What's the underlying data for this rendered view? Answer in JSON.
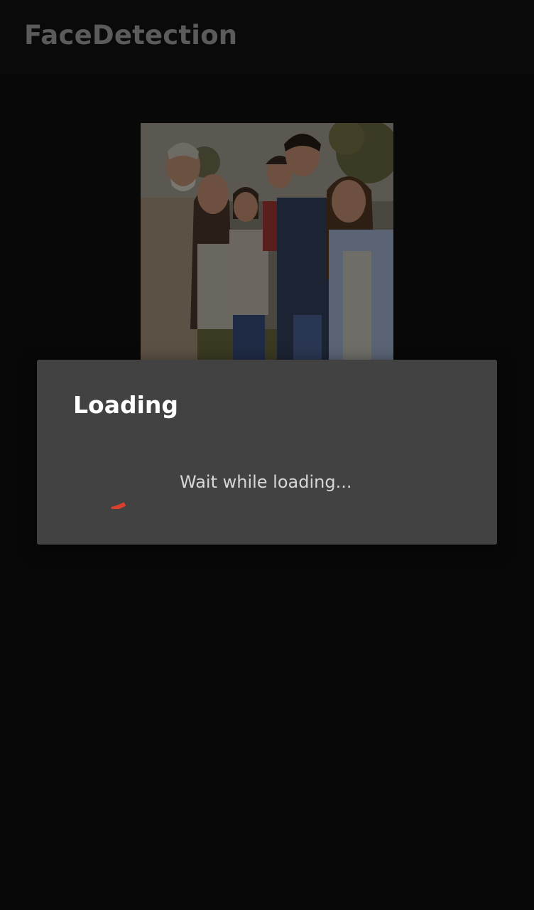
{
  "app_bar": {
    "title": "FaceDetection"
  },
  "content": {
    "photo_icon": "group-photo-image"
  },
  "dialog": {
    "title": "Loading",
    "message": "Wait while loading...",
    "spinner_icon": "progress-spinner-icon"
  },
  "colors": {
    "background": "#080808",
    "dialog_background": "#424242",
    "accent": "#d8402e",
    "title_text": "#ffffff",
    "message_text": "#d6d6d6"
  }
}
